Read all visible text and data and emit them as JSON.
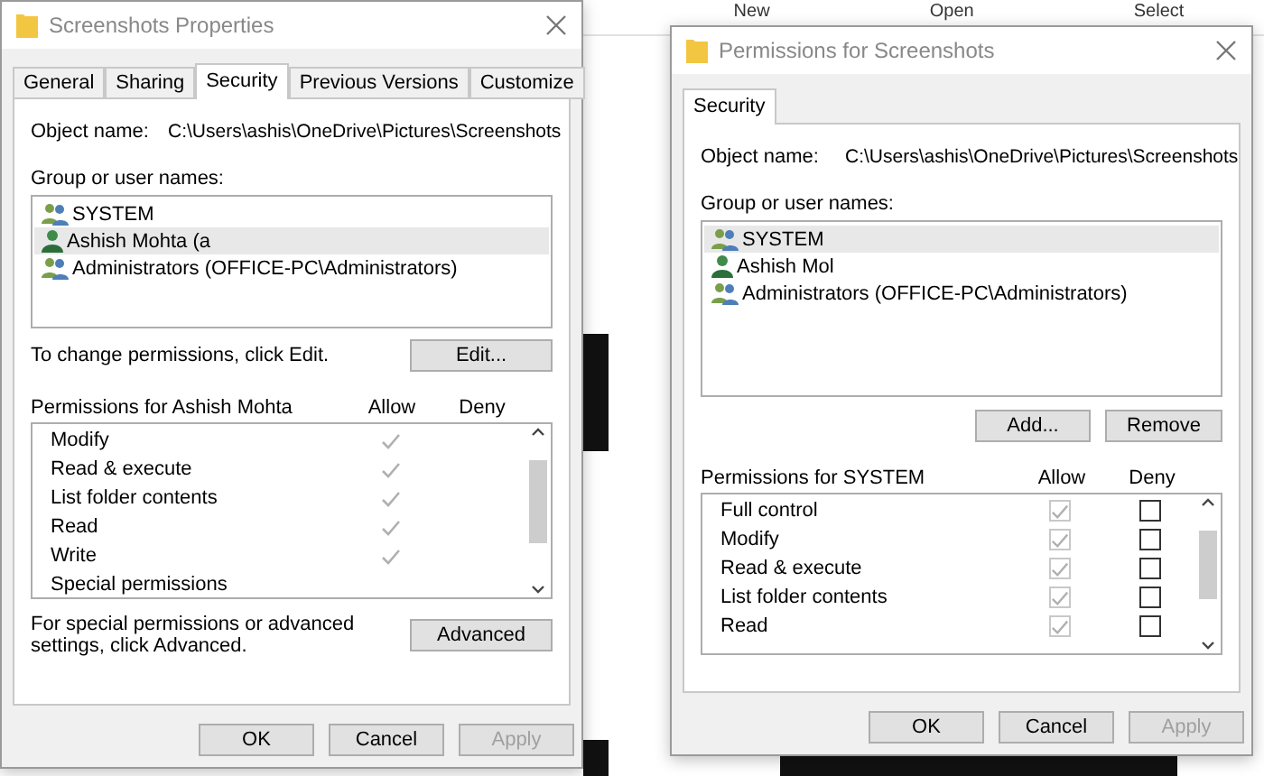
{
  "background_toolbar": {
    "items": [
      "New",
      "Open",
      "Select"
    ]
  },
  "properties_dialog": {
    "title": "Screenshots Properties",
    "tabs": [
      {
        "label": "General",
        "selected": false
      },
      {
        "label": "Sharing",
        "selected": false
      },
      {
        "label": "Security",
        "selected": true
      },
      {
        "label": "Previous Versions",
        "selected": false
      },
      {
        "label": "Customize",
        "selected": false
      }
    ],
    "object_label": "Object name:",
    "object_value": "C:\\Users\\ashis\\OneDrive\\Pictures\\Screenshots",
    "group_label": "Group or user names:",
    "users": [
      {
        "name": "SYSTEM",
        "kind": "group",
        "selected": false
      },
      {
        "name": "Ashish Mohta (a",
        "kind": "user",
        "selected": true
      },
      {
        "name": "Administrators (OFFICE-PC\\Administrators)",
        "kind": "group",
        "selected": false
      }
    ],
    "change_hint": "To change permissions, click Edit.",
    "edit_button": "Edit...",
    "permissions_label": "Permissions for Ashish Mohta",
    "allow_label": "Allow",
    "deny_label": "Deny",
    "permissions": [
      {
        "name": "Modify",
        "kind": "tick",
        "allow": true
      },
      {
        "name": "Read & execute",
        "kind": "tick",
        "allow": true
      },
      {
        "name": "List folder contents",
        "kind": "tick",
        "allow": true
      },
      {
        "name": "Read",
        "kind": "tick",
        "allow": true
      },
      {
        "name": "Write",
        "kind": "tick",
        "allow": true
      },
      {
        "name": "Special permissions",
        "kind": "tick",
        "allow": false
      }
    ],
    "advanced_hint": "For special permissions or advanced settings, click Advanced.",
    "advanced_button": "Advanced",
    "buttons": [
      {
        "label": "OK",
        "disabled": false
      },
      {
        "label": "Cancel",
        "disabled": false
      },
      {
        "label": "Apply",
        "disabled": true
      }
    ]
  },
  "permissions_dialog": {
    "title": "Permissions for Screenshots",
    "tabs": [
      {
        "label": "Security",
        "selected": true
      }
    ],
    "object_label": "Object name:",
    "object_value": "C:\\Users\\ashis\\OneDrive\\Pictures\\Screenshots",
    "group_label": "Group or user names:",
    "users": [
      {
        "name": "SYSTEM",
        "kind": "group",
        "selected": true
      },
      {
        "name": "Ashish Mol",
        "kind": "user",
        "selected": false
      },
      {
        "name": "Administrators (OFFICE-PC\\Administrators)",
        "kind": "group",
        "selected": false
      }
    ],
    "add_button": "Add...",
    "remove_button": "Remove",
    "permissions_label": "Permissions for SYSTEM",
    "allow_label": "Allow",
    "deny_label": "Deny",
    "permissions": [
      {
        "name": "Full control",
        "kind": "checkbox",
        "allow": true,
        "deny": false
      },
      {
        "name": "Modify",
        "kind": "checkbox",
        "allow": true,
        "deny": false
      },
      {
        "name": "Read & execute",
        "kind": "checkbox",
        "allow": true,
        "deny": false
      },
      {
        "name": "List folder contents",
        "kind": "checkbox",
        "allow": true,
        "deny": false
      },
      {
        "name": "Read",
        "kind": "checkbox",
        "allow": true,
        "deny": false
      }
    ],
    "buttons": [
      {
        "label": "OK",
        "disabled": false
      },
      {
        "label": "Cancel",
        "disabled": false
      },
      {
        "label": "Apply",
        "disabled": true
      }
    ]
  }
}
